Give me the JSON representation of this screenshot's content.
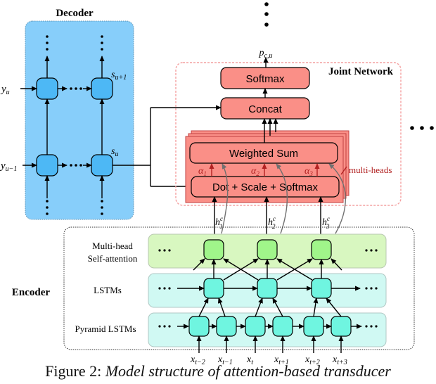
{
  "decoder": {
    "title": "Decoder",
    "inputs": [
      "y_u",
      "y_{u-1}"
    ],
    "states": [
      "s_{u+1}",
      "s_u"
    ],
    "fill": "#87cefa",
    "cell_fill": "#4db8f5"
  },
  "joint_network": {
    "title": "Joint Network",
    "output": "p_{c,u}",
    "blocks": {
      "softmax": "Softmax",
      "concat": "Concat",
      "weighted_sum": "Weighted Sum",
      "dot_scale_softmax": "Dot + Scale + Softmax"
    },
    "alphas": [
      "α1",
      "α2",
      "α3"
    ],
    "multi_heads_label": "multi-heads",
    "fill": "#fa8f87",
    "border": "#f08080",
    "accent": "#b22222"
  },
  "encoder": {
    "title": "Encoder",
    "layers": [
      {
        "label_lines": [
          "Multi-head",
          "Self-attention"
        ],
        "fill": "#d8f7c0",
        "cell_fill": "#a0f58a"
      },
      {
        "label_lines": [
          "LSTMs"
        ],
        "fill": "#d0f9f3",
        "cell_fill": "#6ff5e0"
      },
      {
        "label_lines": [
          "Pyramid LSTMs"
        ],
        "fill": "#d0f9f3",
        "cell_fill": "#6ff5e0"
      }
    ],
    "context_vectors": [
      "h1c",
      "h2c",
      "h3c"
    ],
    "inputs": [
      "x_{t-2}",
      "x_{t-1}",
      "x_t",
      "x_{t+1}",
      "x_{t+2}",
      "x_{t+3}"
    ]
  },
  "caption": {
    "prefix": "Figure 2: ",
    "text": "Model structure of attention-based transducer"
  }
}
